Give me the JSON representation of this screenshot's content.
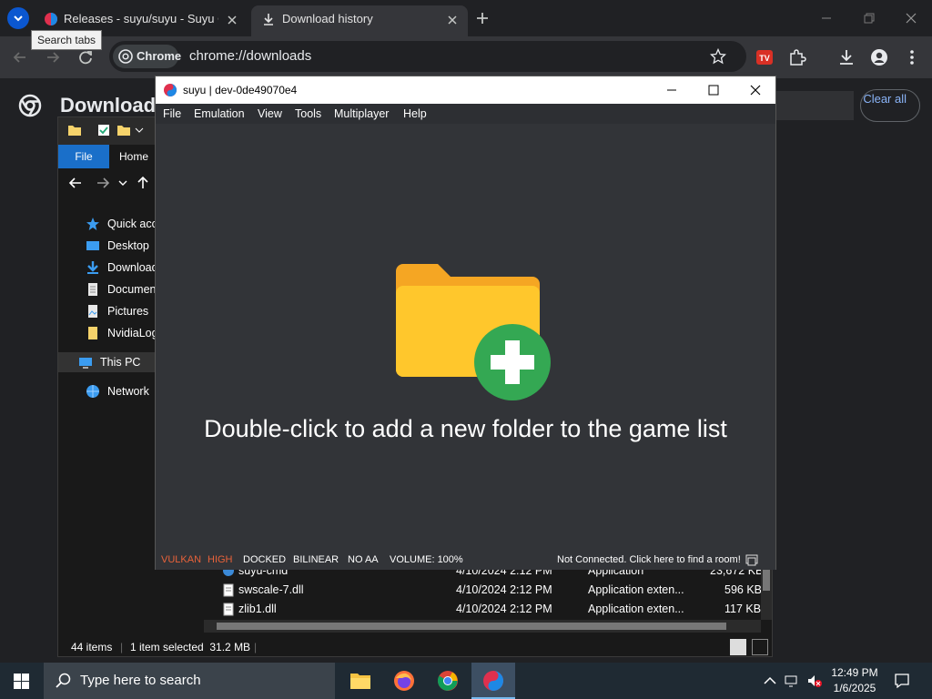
{
  "chrome": {
    "tabs": [
      {
        "title": "Releases - suyu/suyu - Suyu Git"
      },
      {
        "title": "Download history"
      }
    ],
    "tooltip": "Search tabs",
    "omnibox_chip": "Chrome",
    "url": "chrome://downloads"
  },
  "downloads": {
    "title": "Download",
    "clear_all": "Clear all"
  },
  "explorer": {
    "ribbon": {
      "file": "File",
      "home": "Home"
    },
    "nav": [
      {
        "label": "Quick acces",
        "icon": "star-icon"
      },
      {
        "label": "Desktop",
        "icon": "desktop-icon"
      },
      {
        "label": "Download",
        "icon": "download-icon"
      },
      {
        "label": "Documen",
        "icon": "document-icon"
      },
      {
        "label": "Pictures",
        "icon": "pictures-icon"
      },
      {
        "label": "NvidiaLog",
        "icon": "folder-icon"
      },
      {
        "label": "This PC",
        "icon": "computer-icon"
      },
      {
        "label": "Network",
        "icon": "network-icon"
      }
    ],
    "files": [
      {
        "name": "suyu-cmd",
        "date": "4/10/2024 2:12 PM",
        "type": "Application",
        "size": "23,672 KB"
      },
      {
        "name": "swscale-7.dll",
        "date": "4/10/2024 2:12 PM",
        "type": "Application exten...",
        "size": "596 KB"
      },
      {
        "name": "zlib1.dll",
        "date": "4/10/2024 2:12 PM",
        "type": "Application exten...",
        "size": "117 KB"
      }
    ],
    "status": {
      "items": "44 items",
      "selected": "1 item selected  31.2 MB"
    }
  },
  "suyu": {
    "title": "suyu | dev-0de49070e4",
    "menu": [
      "File",
      "Emulation",
      "View",
      "Tools",
      "Multiplayer",
      "Help"
    ],
    "message": "Double-click to add a new folder to the game list",
    "status": {
      "api": "VULKAN",
      "accuracy": "HIGH",
      "mode": "DOCKED",
      "filter": "BILINEAR",
      "aa": "NO AA",
      "volume": "VOLUME: 100%",
      "network": "Not Connected. Click here to find a room!"
    },
    "colors": {
      "api": "#e8623a",
      "accuracy": "#e8623a"
    }
  },
  "taskbar": {
    "search_placeholder": "Type here to search",
    "time": "12:49 PM",
    "date": "1/6/2025"
  }
}
